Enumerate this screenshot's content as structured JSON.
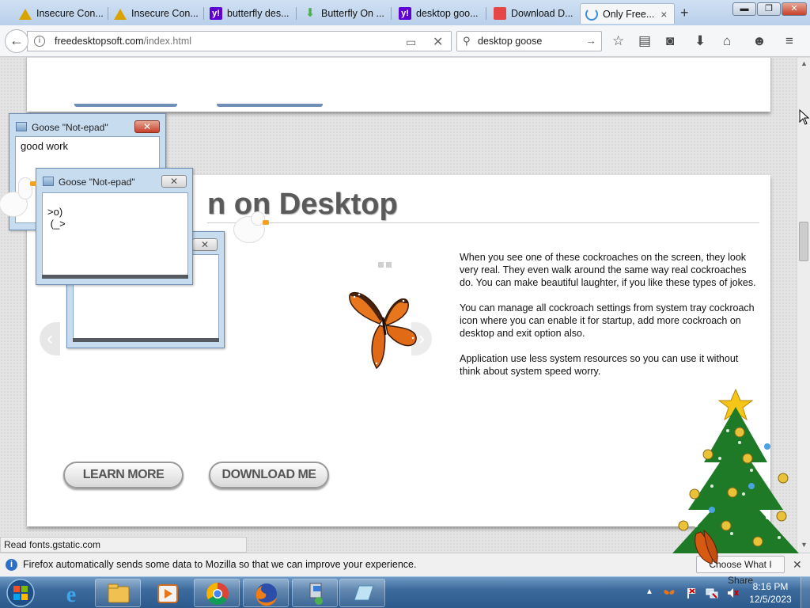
{
  "browser": {
    "tabs": [
      {
        "title": "Insecure Con...",
        "icon": "warning-icon",
        "active": false
      },
      {
        "title": "Insecure Con...",
        "icon": "warning-icon",
        "active": false
      },
      {
        "title": "butterfly des...",
        "icon": "yahoo-icon",
        "active": false
      },
      {
        "title": "Butterfly On ...",
        "icon": "download-icon",
        "active": false
      },
      {
        "title": "desktop goo...",
        "icon": "yahoo-icon",
        "active": false
      },
      {
        "title": "Download D...",
        "icon": "calendar-icon",
        "active": false
      },
      {
        "title": "Only Free...",
        "icon": "loading-icon",
        "active": true
      }
    ],
    "tab_close": "×",
    "new_tab": "+",
    "window_controls": {
      "minimize": "▬",
      "maximize": "❐",
      "close": "✕"
    },
    "url": {
      "host": "freedesktopsoft.com",
      "path": "/index.html"
    },
    "search": {
      "value": "desktop goose"
    },
    "toolbar_icons": [
      "star-icon",
      "reading-list-icon",
      "pocket-icon",
      "download-icon",
      "home-icon",
      "smiley-icon",
      "menu-icon"
    ]
  },
  "page": {
    "hero_title": "n on Desktop",
    "description": [
      "When you see one of these cockroaches on the screen, they look very real. They even walk around the same way real cockroaches do. You can make beautiful laughter, if you like these types of jokes.",
      "You can manage all cockroach settings from system tray cockroach icon where you can enable it for startup, add more cockroach on desktop and exit option also.",
      "Application use less system resources so you can use it without think about system speed worry."
    ],
    "buttons": {
      "learn_more": "LEARN MORE",
      "download": "DOWNLOAD ME"
    },
    "slider_prev": "‹",
    "slider_next": "›"
  },
  "goose_windows": [
    {
      "title": "Goose \"Not-epad\"",
      "body": "good work",
      "close": "✕"
    },
    {
      "title": "Goose \"Not-epad\"",
      "body": ">o)\n (_>",
      "close": "✕"
    },
    {
      "title": "",
      "body": "",
      "close": "✕"
    }
  ],
  "statusbar": {
    "text": "Read fonts.gstatic.com"
  },
  "notification": {
    "icon": "i",
    "text": "Firefox automatically sends some data to Mozilla so that we can improve your experience.",
    "button": "Choose What I Share",
    "close": "✕"
  },
  "taskbar": {
    "time": "8:16 PM",
    "date": "12/5/2023",
    "items": [
      "start-orb-icon",
      "internet-explorer-icon",
      "file-explorer-icon",
      "media-player-icon",
      "chrome-icon",
      "firefox-icon",
      "network-app-icon",
      "notepad-icon"
    ]
  }
}
